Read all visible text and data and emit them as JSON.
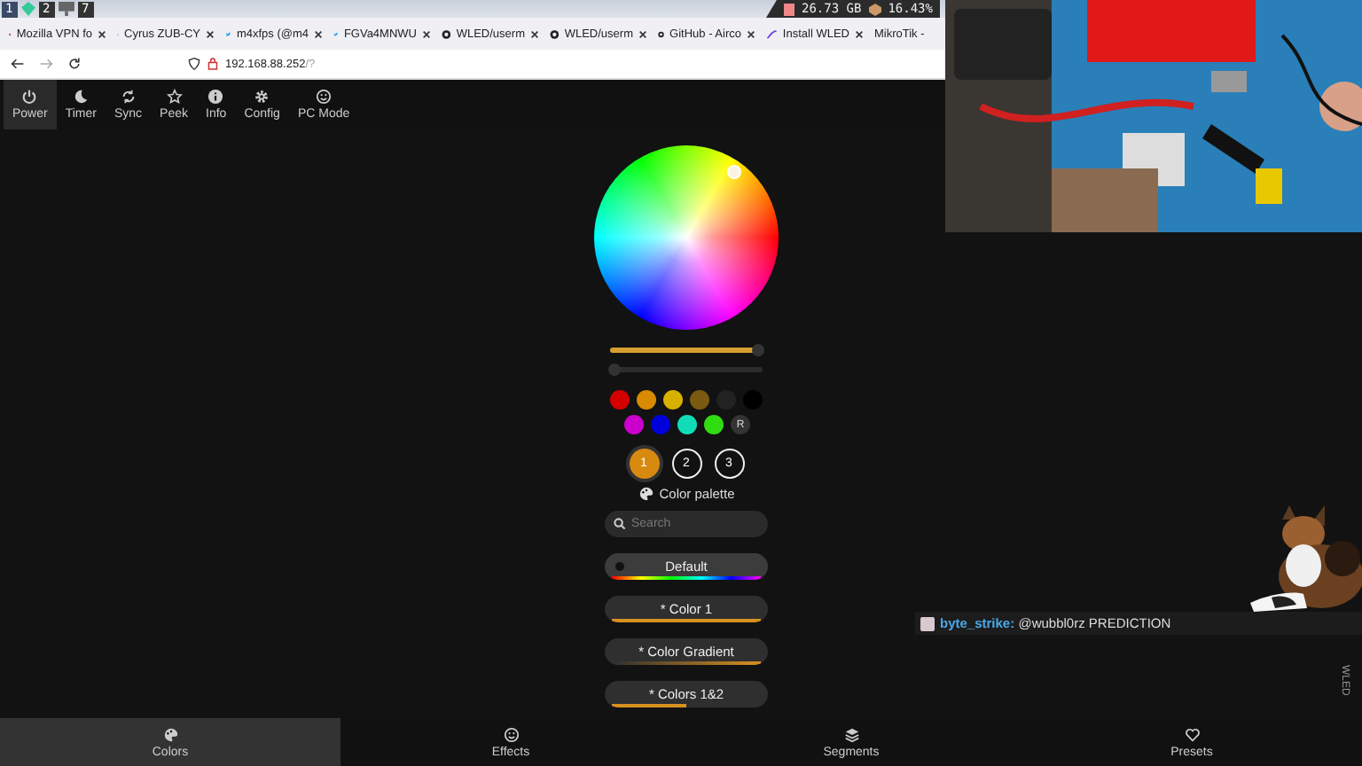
{
  "system_bar": {
    "workspaces": [
      {
        "label": "1",
        "selected": true
      },
      {
        "label": "2",
        "selected": false
      },
      {
        "label": "7",
        "selected": false
      }
    ],
    "disk": "26.73 GB",
    "battery": "16.43%"
  },
  "browser_tabs": [
    {
      "title": "Mozilla VPN fo",
      "kind": "firefox"
    },
    {
      "title": "Cyrus ZUB-CY",
      "kind": "google"
    },
    {
      "title": "m4xfps (@m4",
      "kind": "bird"
    },
    {
      "title": "FGVa4MNWU",
      "kind": "bird"
    },
    {
      "title": "WLED/userm",
      "kind": "github"
    },
    {
      "title": "WLED/userm",
      "kind": "github"
    },
    {
      "title": "GitHub - Airco",
      "kind": "github"
    },
    {
      "title": "Install WLED",
      "kind": "wled"
    },
    {
      "title": "MikroTik -",
      "kind": "plain"
    }
  ],
  "address": {
    "host": "192.168.88.252",
    "path": "/?"
  },
  "top_menu": [
    {
      "label": "Power",
      "kind": "power",
      "selected": true
    },
    {
      "label": "Timer",
      "kind": "moon",
      "selected": false
    },
    {
      "label": "Sync",
      "kind": "sync",
      "selected": false
    },
    {
      "label": "Peek",
      "kind": "star",
      "selected": false
    },
    {
      "label": "Info",
      "kind": "info",
      "selected": false
    },
    {
      "label": "Config",
      "kind": "gear",
      "selected": false
    },
    {
      "label": "PC Mode",
      "kind": "smile",
      "selected": false
    }
  ],
  "sliders": [
    {
      "level": 0.97
    },
    {
      "level": 0.03
    }
  ],
  "swatches": [
    {
      "kind": "color",
      "color": "#d40000"
    },
    {
      "kind": "color",
      "color": "#d88a00"
    },
    {
      "kind": "color",
      "color": "#d8b000"
    },
    {
      "kind": "color",
      "color": "#7a5a10"
    },
    {
      "kind": "color",
      "color": "#222222"
    },
    {
      "kind": "color",
      "color": "#000000"
    },
    {
      "kind": "color",
      "color": "#cc00cc"
    },
    {
      "kind": "color",
      "color": "#0000dd"
    },
    {
      "kind": "color",
      "color": "#10dcb8"
    },
    {
      "kind": "color",
      "color": "#30dd10"
    },
    {
      "kind": "random",
      "label": "R"
    }
  ],
  "color_slots": [
    {
      "label": "1",
      "selected": true
    },
    {
      "label": "2",
      "selected": false
    },
    {
      "label": "3",
      "selected": false
    }
  ],
  "palette_heading": "Color palette",
  "search": {
    "placeholder": "Search"
  },
  "palettes": [
    {
      "name": "Default",
      "selected": true,
      "kind": "rainbow"
    },
    {
      "name": "* Color 1",
      "selected": false,
      "kind": "solid"
    },
    {
      "name": "* Color Gradient",
      "selected": false,
      "kind": "gradient"
    },
    {
      "name": "* Colors 1&2",
      "selected": false,
      "kind": "dual"
    }
  ],
  "bottom_nav": [
    {
      "label": "Colors",
      "kind": "palette",
      "selected": true
    },
    {
      "label": "Effects",
      "kind": "smile",
      "selected": false
    },
    {
      "label": "Segments",
      "kind": "layers",
      "selected": false
    },
    {
      "label": "Presets",
      "kind": "heart",
      "selected": false
    }
  ],
  "chat": {
    "user": "byte_strike:",
    "message": "@wubbl0rz PREDICTION"
  },
  "side_label": "WLED"
}
